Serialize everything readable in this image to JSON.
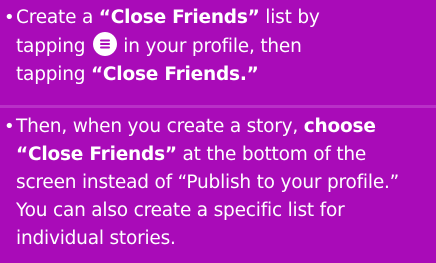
{
  "tips": [
    {
      "line1_a": "Create a ",
      "line1_bold": "“Close Friends”",
      "line1_b": " list by",
      "line2_a": "tapping",
      "line2_b": "in your profile, then",
      "line3_a": "tapping ",
      "line3_bold": "“Close Friends.”"
    },
    {
      "part_a": "Then, when you create a story, ",
      "bold_1": "choose",
      "bold_2": "“Close Friends”",
      "part_b": " at the bottom of the screen instead of “Publish to your profile.” You can also create a specific list for individual stories."
    }
  ],
  "bullet": "•",
  "icons": {
    "menu": "hamburger-menu-icon"
  },
  "colors": {
    "background": "#a90bb8",
    "text": "#ffffff",
    "icon_bg": "#ffffff",
    "icon_lines": "#a90bb8"
  }
}
